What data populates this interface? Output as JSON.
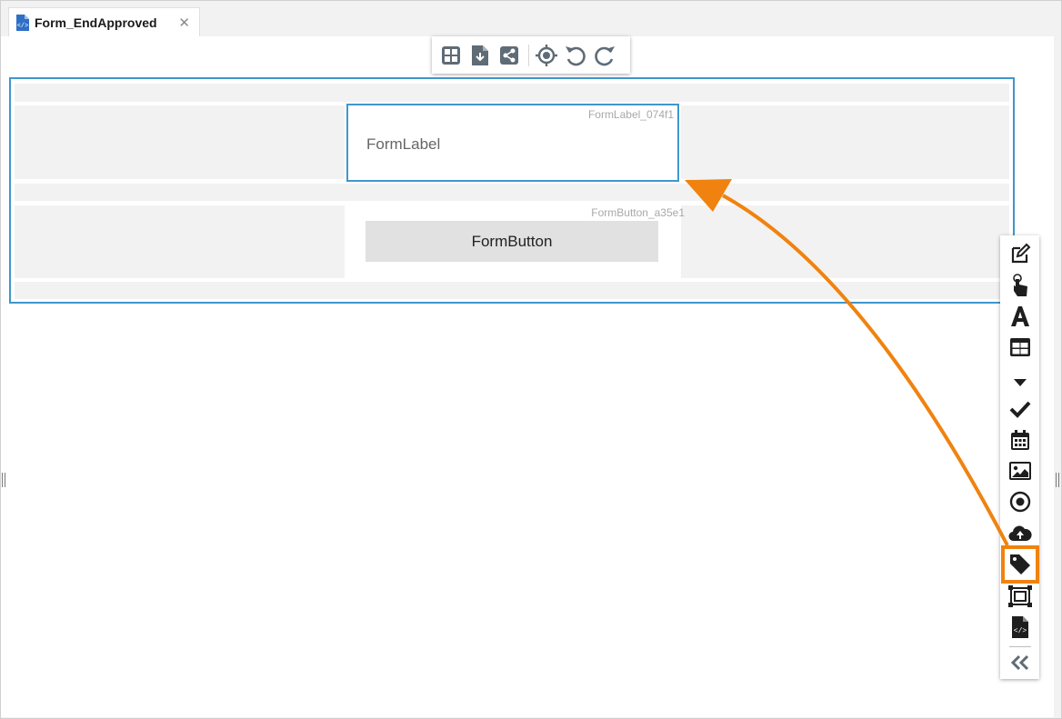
{
  "tab": {
    "title": "Form_EndApproved",
    "close_symbol": "✕",
    "icon": "form-document-icon"
  },
  "toolbar": {
    "buttons": [
      "grid-layout-icon",
      "download-document-icon",
      "share-icon",
      "target-icon",
      "undo-icon",
      "redo-icon"
    ]
  },
  "form": {
    "label": {
      "id": "FormLabel_074f1",
      "text": "FormLabel"
    },
    "button": {
      "id": "FormButton_a35e1",
      "text": "FormButton"
    }
  },
  "toolbox": {
    "tools": [
      "edit-icon",
      "pointer-hand-icon",
      "text-icon",
      "table-icon",
      "dropdown-icon",
      "checkmark-icon",
      "calendar-icon",
      "image-icon",
      "radio-icon",
      "upload-cloud-icon",
      "tag-icon",
      "container-icon",
      "html-document-icon",
      "collapse-icon"
    ],
    "highlighted_tool": "tag-icon"
  },
  "colors": {
    "selection_border": "#3f96cc",
    "highlight": "#f0830f",
    "icon": "#1e1e1e",
    "toolbar_icon": "#5f6b75"
  }
}
